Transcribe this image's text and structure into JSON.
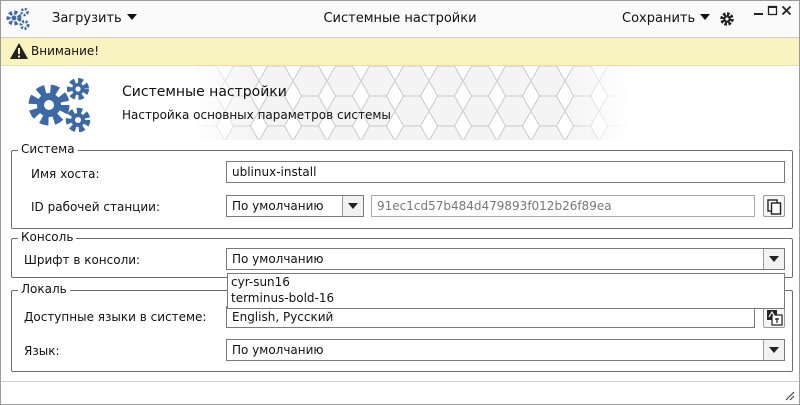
{
  "titlebar": {
    "load_label": "Загрузить",
    "title": "Системные настройки",
    "save_label": "Сохранить"
  },
  "warning": {
    "text": "Внимание!"
  },
  "header": {
    "title": "Системные настройки",
    "subtitle": "Настройка основных параметров системы"
  },
  "system": {
    "legend": "Система",
    "hostname_label": "Имя хоста:",
    "hostname_value": "ublinux-install",
    "machine_id_label": "ID рабочей станции:",
    "machine_id_mode": "По умолчанию",
    "machine_id_value": "91ec1cd57b484d479893f012b26f89ea"
  },
  "console": {
    "legend": "Консоль",
    "font_label": "Шрифт в консоли:",
    "font_value": "По умолчанию",
    "font_options": [
      "cyr-sun16",
      "terminus-bold-16"
    ]
  },
  "locale": {
    "legend": "Локаль",
    "available_label": "Доступные языки в системе:",
    "available_value": "English, Русский",
    "language_label": "Язык:",
    "language_value": "По умолчанию"
  },
  "icons": {
    "app": "gears-icon",
    "settings": "gear-icon",
    "warning": "warning-icon",
    "copy": "copy-icon",
    "translate": "translate-icon",
    "resize": "resize-grip-icon"
  },
  "colors": {
    "gear_blue": "#3c69a6",
    "warning_bg": "#f8f3bf"
  }
}
